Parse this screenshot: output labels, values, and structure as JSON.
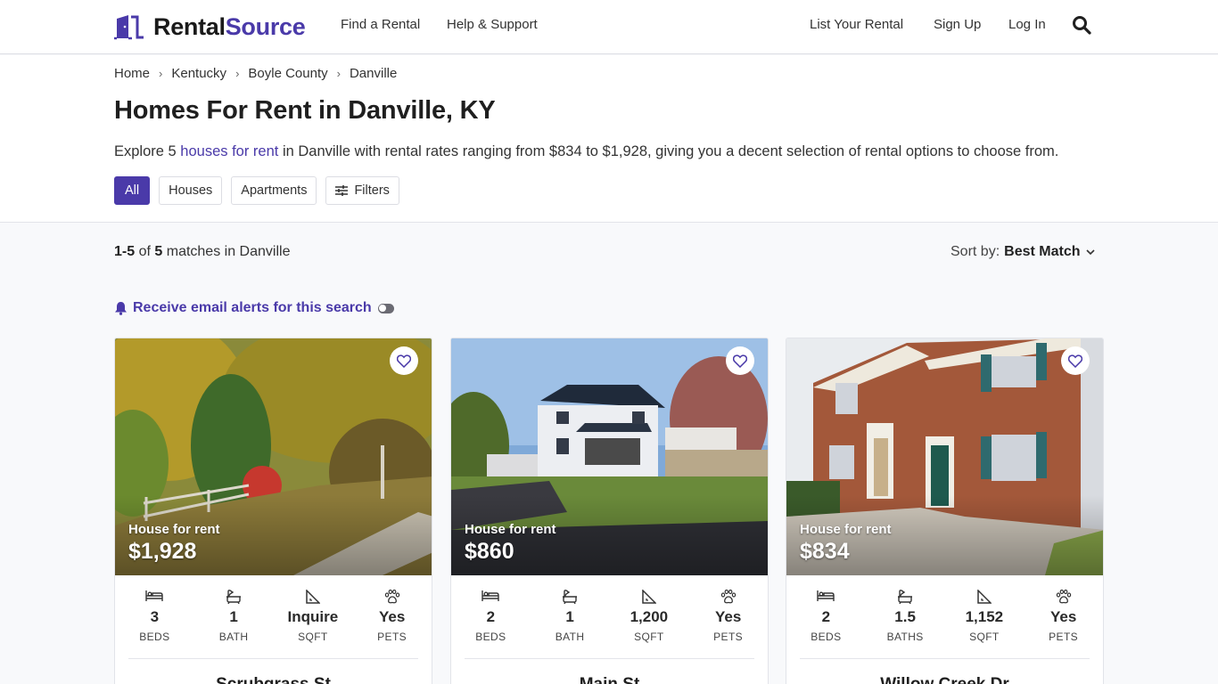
{
  "brand": {
    "name_part1": "Rental",
    "name_part2": "Source",
    "accent": "#4a3aa9"
  },
  "nav": {
    "left": [
      "Find a Rental",
      "Help & Support"
    ],
    "right": [
      "List Your Rental",
      "Sign Up",
      "Log In"
    ],
    "search_icon": "search-icon"
  },
  "breadcrumb": [
    "Home",
    "Kentucky",
    "Boyle County",
    "Danville"
  ],
  "page": {
    "title": "Homes For Rent in Danville, KY",
    "desc_pre": "Explore 5 ",
    "desc_link": "houses for rent",
    "desc_post": " in Danville with rental rates ranging from $834 to $1,928, giving you a decent selection of rental options to choose from."
  },
  "filters": {
    "chips": [
      "All",
      "Houses",
      "Apartments"
    ],
    "active": "All",
    "filters_label": "Filters"
  },
  "results": {
    "range": "1-5",
    "of_label": "of",
    "total": "5",
    "suffix": "matches in Danville",
    "sort_label": "Sort by:",
    "sort_value": "Best Match"
  },
  "alert": {
    "label": "Receive email alerts for this search",
    "enabled": false
  },
  "listings": [
    {
      "type": "House for rent",
      "price": "$1,928",
      "street": "Scrubgrass St",
      "stats": [
        {
          "icon": "bed-icon",
          "value": "3",
          "label": "BEDS"
        },
        {
          "icon": "bath-icon",
          "value": "1",
          "label": "BATH"
        },
        {
          "icon": "sqft-icon",
          "value": "Inquire",
          "label": "SQFT"
        },
        {
          "icon": "paw-icon",
          "value": "Yes",
          "label": "PETS"
        }
      ]
    },
    {
      "type": "House for rent",
      "price": "$860",
      "street": "Main St",
      "stats": [
        {
          "icon": "bed-icon",
          "value": "2",
          "label": "BEDS"
        },
        {
          "icon": "bath-icon",
          "value": "1",
          "label": "BATH"
        },
        {
          "icon": "sqft-icon",
          "value": "1,200",
          "label": "SQFT"
        },
        {
          "icon": "paw-icon",
          "value": "Yes",
          "label": "PETS"
        }
      ]
    },
    {
      "type": "House for rent",
      "price": "$834",
      "street": "Willow Creek Dr",
      "stats": [
        {
          "icon": "bed-icon",
          "value": "2",
          "label": "BEDS"
        },
        {
          "icon": "bath-icon",
          "value": "1.5",
          "label": "BATHS"
        },
        {
          "icon": "sqft-icon",
          "value": "1,152",
          "label": "SQFT"
        },
        {
          "icon": "paw-icon",
          "value": "Yes",
          "label": "PETS"
        }
      ]
    }
  ]
}
